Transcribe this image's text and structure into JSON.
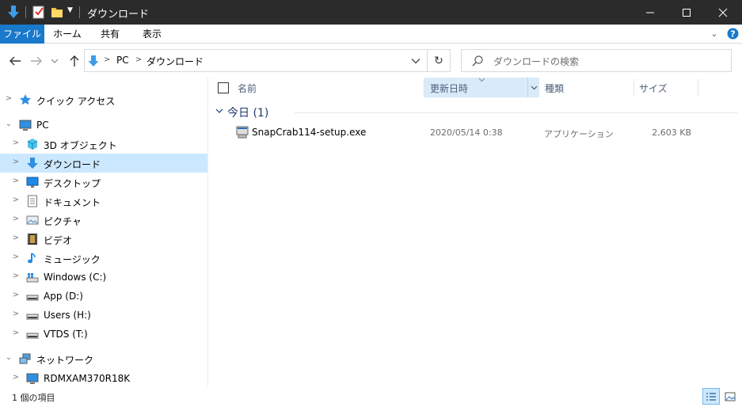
{
  "window": {
    "title": "ダウンロード",
    "controls": {
      "minimize": "—",
      "maximize": "☐",
      "close": "✕"
    }
  },
  "ribbon": {
    "tabs": [
      {
        "label": "ファイル",
        "active": true
      },
      {
        "label": "ホーム"
      },
      {
        "label": "共有"
      },
      {
        "label": "表示"
      }
    ]
  },
  "address": {
    "crumbs": [
      "PC",
      "ダウンロード"
    ],
    "search_placeholder": "ダウンロードの検索"
  },
  "nav": {
    "items": [
      {
        "label": "クイック アクセス",
        "icon": "star-icon"
      },
      {
        "label": "PC",
        "icon": "pc-icon"
      },
      {
        "label": "3D オブジェクト",
        "icon": "cube-icon"
      },
      {
        "label": "ダウンロード",
        "icon": "download-icon",
        "selected": true
      },
      {
        "label": "デスクトップ",
        "icon": "desktop-icon"
      },
      {
        "label": "ドキュメント",
        "icon": "document-icon"
      },
      {
        "label": "ピクチャ",
        "icon": "picture-icon"
      },
      {
        "label": "ビデオ",
        "icon": "video-icon"
      },
      {
        "label": "ミュージック",
        "icon": "music-icon"
      },
      {
        "label": "Windows (C:)",
        "icon": "windows-drive-icon"
      },
      {
        "label": "App (D:)",
        "icon": "drive-icon"
      },
      {
        "label": "Users (H:)",
        "icon": "drive-icon"
      },
      {
        "label": "VTDS (T:)",
        "icon": "drive-icon"
      },
      {
        "label": "ネットワーク",
        "icon": "network-icon"
      },
      {
        "label": "RDMXAM370R18K",
        "icon": "computer-icon"
      }
    ]
  },
  "columns": {
    "name": "名前",
    "date": "更新日時",
    "type": "種類",
    "size": "サイズ"
  },
  "group": {
    "label": "今日 (1)"
  },
  "files": [
    {
      "name": "SnapCrab114-setup.exe",
      "date": "2020/05/14 0:38",
      "type": "アプリケーション",
      "size": "2,603 KB"
    }
  ],
  "status": {
    "count": "1 個の項目"
  },
  "colors": {
    "accent": "#1979ca",
    "selection": "#cce8ff",
    "titlebar": "#2b2b2b"
  }
}
